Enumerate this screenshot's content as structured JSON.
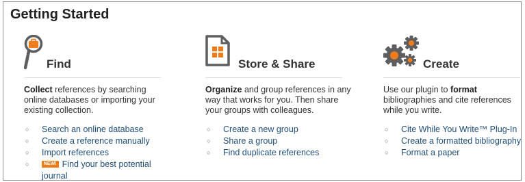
{
  "page": {
    "title": "Getting Started"
  },
  "colors": {
    "accent": "#ef7d1b",
    "link": "#1f4e79",
    "icon_gray": "#5e5e5e"
  },
  "columns": [
    {
      "heading": "Find",
      "icon": "magnifier-icon",
      "desc_bold": "Collect",
      "desc_rest": " references by searching online databases or importing your existing collection.",
      "links": [
        {
          "label": "Search an online database"
        },
        {
          "label": "Create a reference manually"
        },
        {
          "label": "Import references"
        },
        {
          "badge": "NEW!",
          "label_line1": "Find your best potential",
          "label_line2": "journal"
        }
      ]
    },
    {
      "heading": "Store & Share",
      "icon": "document-folder-icon",
      "desc_bold": "Organize",
      "desc_rest": " and group references in any way that works for you. Then share your groups with colleagues.",
      "links": [
        {
          "label": "Create a new group"
        },
        {
          "label": "Share a group"
        },
        {
          "label": "Find duplicate references"
        }
      ]
    },
    {
      "heading": "Create",
      "icon": "gears-icon",
      "desc_pre": "Use our plugin to ",
      "desc_bold": "format",
      "desc_rest": " bibliographies and cite references while you write.",
      "links": [
        {
          "label": "Cite While You Write™ Plug-In"
        },
        {
          "label": "Create a formatted bibliography"
        },
        {
          "label": "Format a paper"
        }
      ]
    }
  ]
}
